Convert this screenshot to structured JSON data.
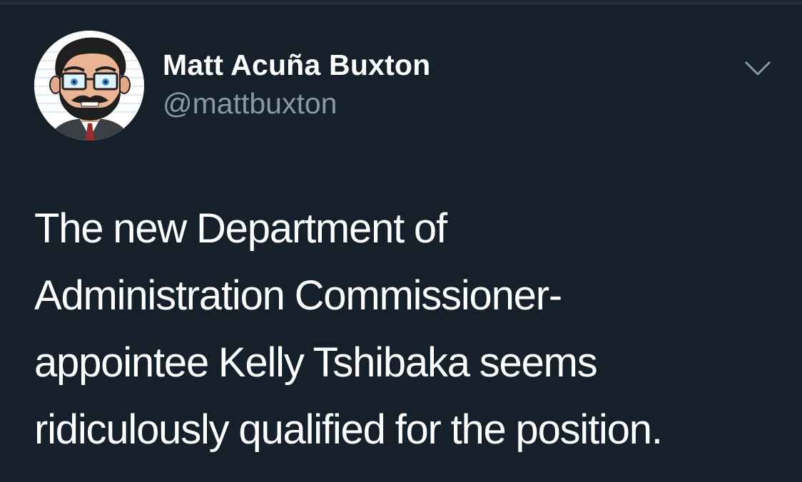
{
  "tweet": {
    "author": {
      "display_name": "Matt Acuña Buxton",
      "handle": "@mattbuxton",
      "avatar_icon": "cartoon-avatar-icon"
    },
    "menu_icon": "chevron-down-icon",
    "text_lines": [
      "The new Department of",
      "Administration Commissioner-",
      "appointee Kelly Tshibaka seems",
      "ridiculously qualified for the position."
    ]
  },
  "colors": {
    "background": "#15202b",
    "primary_text": "#ffffff",
    "secondary_text": "#8899a6"
  }
}
